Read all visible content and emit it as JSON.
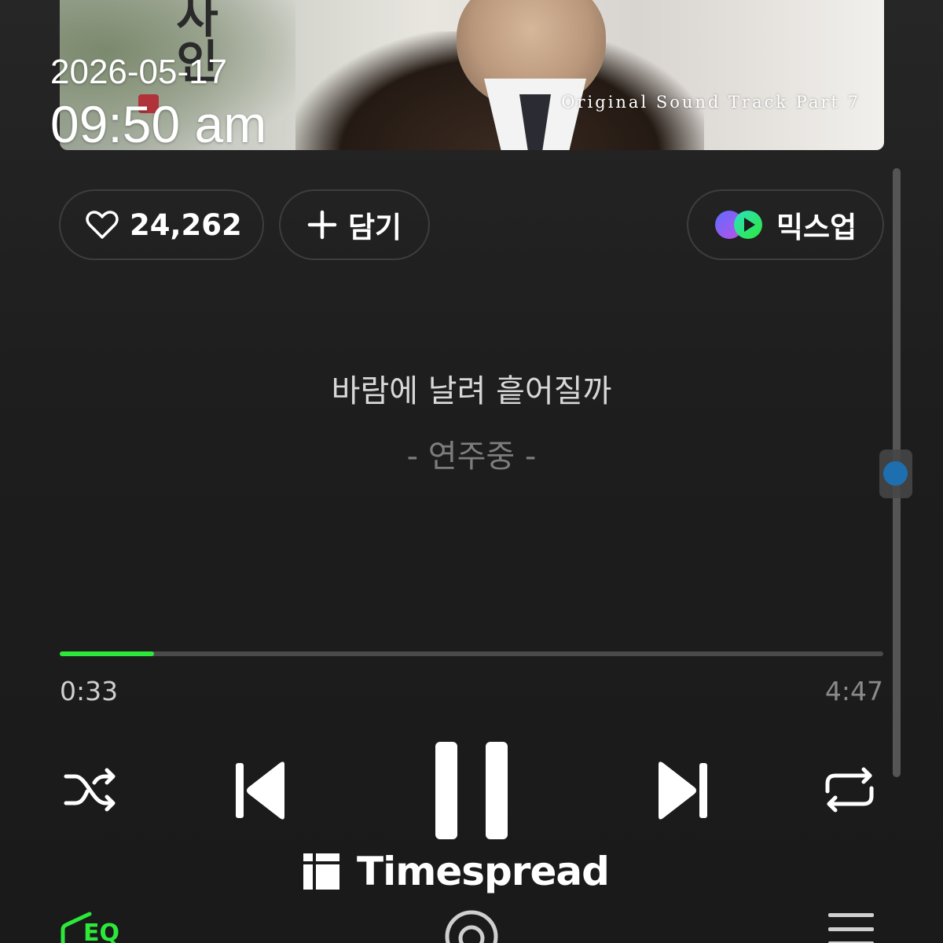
{
  "overlay": {
    "date": "2026-05-17",
    "time": "09:50 am"
  },
  "album": {
    "title_calligraphy": "사인",
    "caption": "Original Sound Track Part 7"
  },
  "actions": {
    "like_count": "24,262",
    "add_label": "담기",
    "mixup_label": "믹스업"
  },
  "lyrics": {
    "current_line": "바람에 날려 흩어질까",
    "status": "- 연주중 -"
  },
  "playback": {
    "elapsed": "0:33",
    "total": "4:47",
    "progress_fraction": 0.1149
  },
  "watermark": {
    "text": "Timespread"
  },
  "bottom_bar": {
    "eq_label": "EQ"
  },
  "colors": {
    "accent_green": "#2de83a",
    "background": "#1c1c1c",
    "scroll_thumb": "#1e6fb0"
  },
  "icons": {
    "like": "heart-icon",
    "add": "plus-icon",
    "mixup": "mixup-icon",
    "shuffle": "shuffle-icon",
    "previous": "skip-previous-icon",
    "pause": "pause-icon",
    "next": "skip-next-icon",
    "repeat": "repeat-icon",
    "eq": "eq-icon",
    "center": "lens-icon",
    "menu": "menu-icon"
  }
}
